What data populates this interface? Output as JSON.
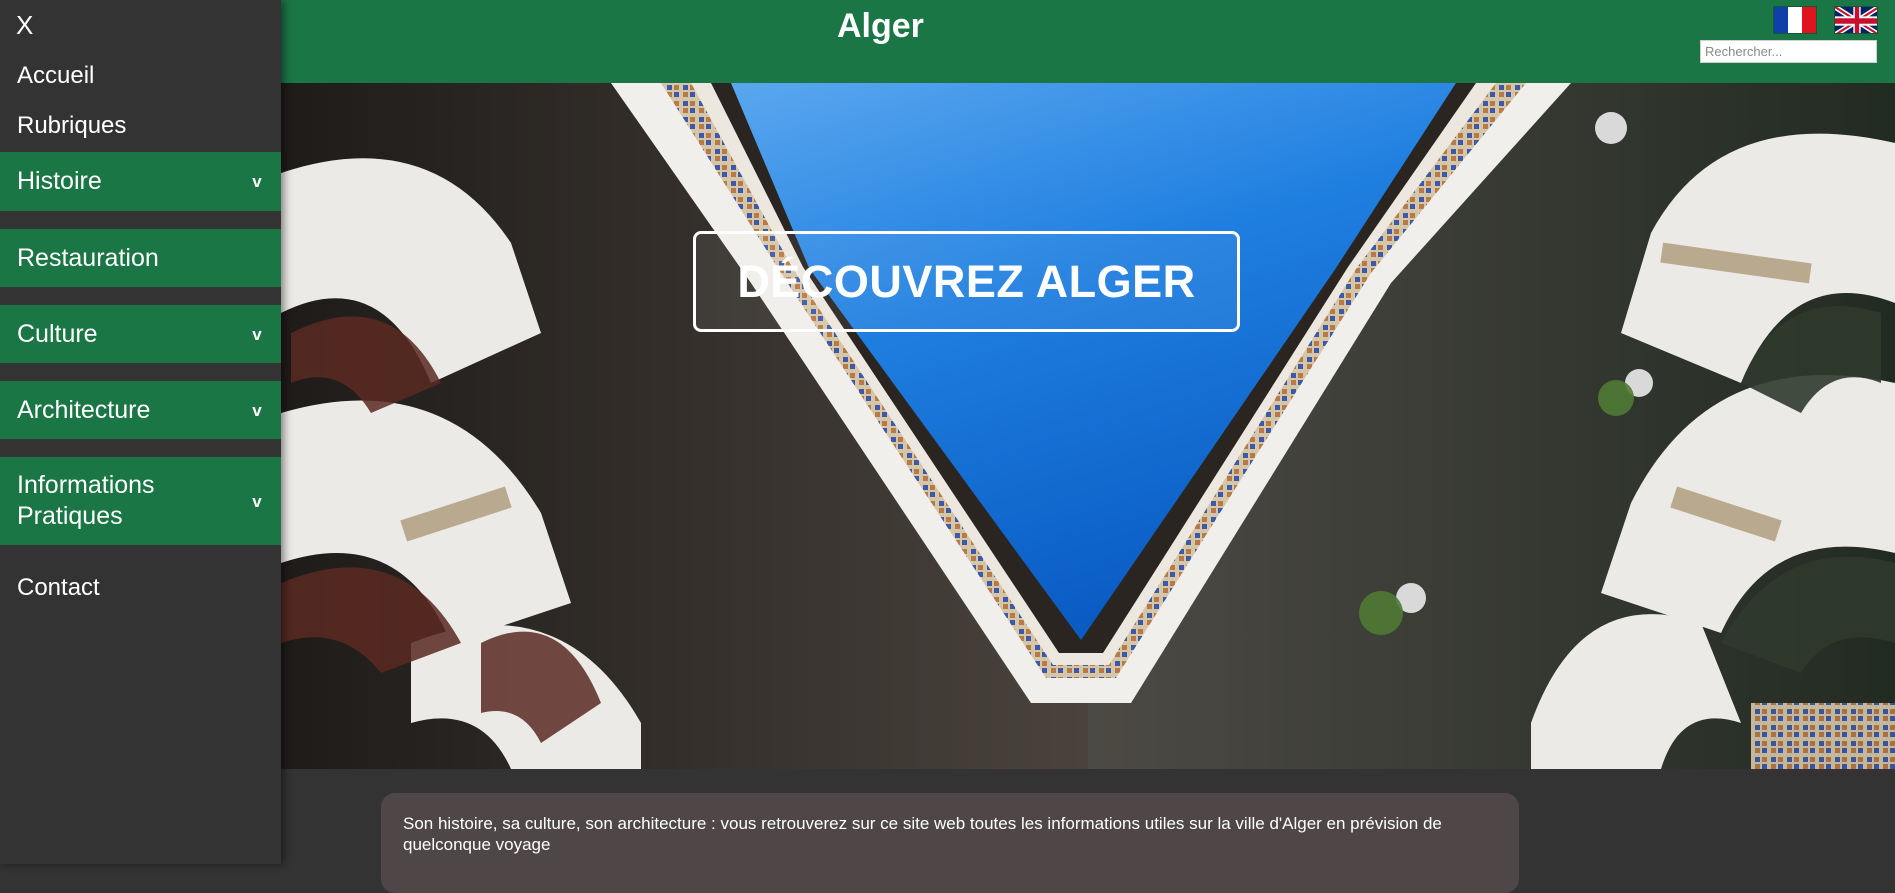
{
  "sidebar": {
    "close_label": "X",
    "items": [
      {
        "label": "Accueil"
      },
      {
        "label": "Rubriques"
      },
      {
        "label": "Histoire",
        "chevron": "v"
      },
      {
        "label": "Restauration"
      },
      {
        "label": "Culture",
        "chevron": "v"
      },
      {
        "label": "Architecture",
        "chevron": "v"
      },
      {
        "label": "Informations Pratiques",
        "chevron": "v"
      },
      {
        "label": "Contact"
      }
    ]
  },
  "header": {
    "title": "Alger",
    "languages": [
      {
        "name": "Français",
        "icon": "flag-fr-icon"
      },
      {
        "name": "English",
        "icon": "flag-uk-icon"
      }
    ],
    "search": {
      "placeholder": "Rechercher...",
      "value": ""
    }
  },
  "hero": {
    "cta_label": "DÉCOUVREZ ALGER",
    "image": "courtyard-sky-photo"
  },
  "intro": {
    "text": "Son histoire, sa culture, son architecture : vous retrouverez sur ce site web toutes les informations utiles sur la ville d'Alger en prévision de quelconque voyage"
  },
  "colors": {
    "brand_green": "#1b7645",
    "sidebar_bg": "#333333",
    "card_bg": "#4f4647"
  }
}
